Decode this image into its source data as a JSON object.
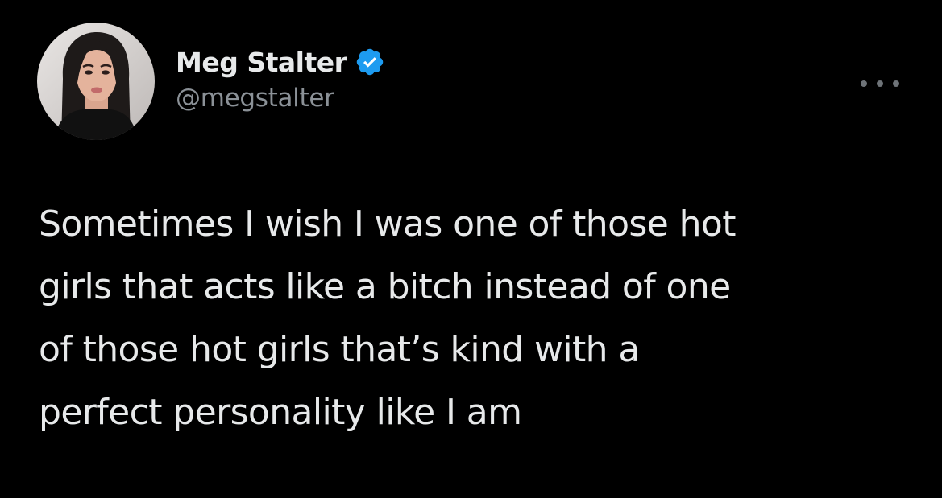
{
  "author": {
    "display_name": "Meg Stalter",
    "handle": "@megstalter",
    "verified": true,
    "avatar_icon": "profile-photo"
  },
  "menu": {
    "icon": "more-options-icon"
  },
  "tweet": {
    "lines": [
      "Sometimes I wish I was one of those hot",
      "girls that acts like a bitch instead of one",
      "of those hot girls that’s kind with a",
      "perfect personality like I am"
    ]
  },
  "colors": {
    "background": "#000000",
    "text": "#e7e9ea",
    "secondary_text": "#8b9197",
    "verified_badge": "#1d9bf0"
  }
}
